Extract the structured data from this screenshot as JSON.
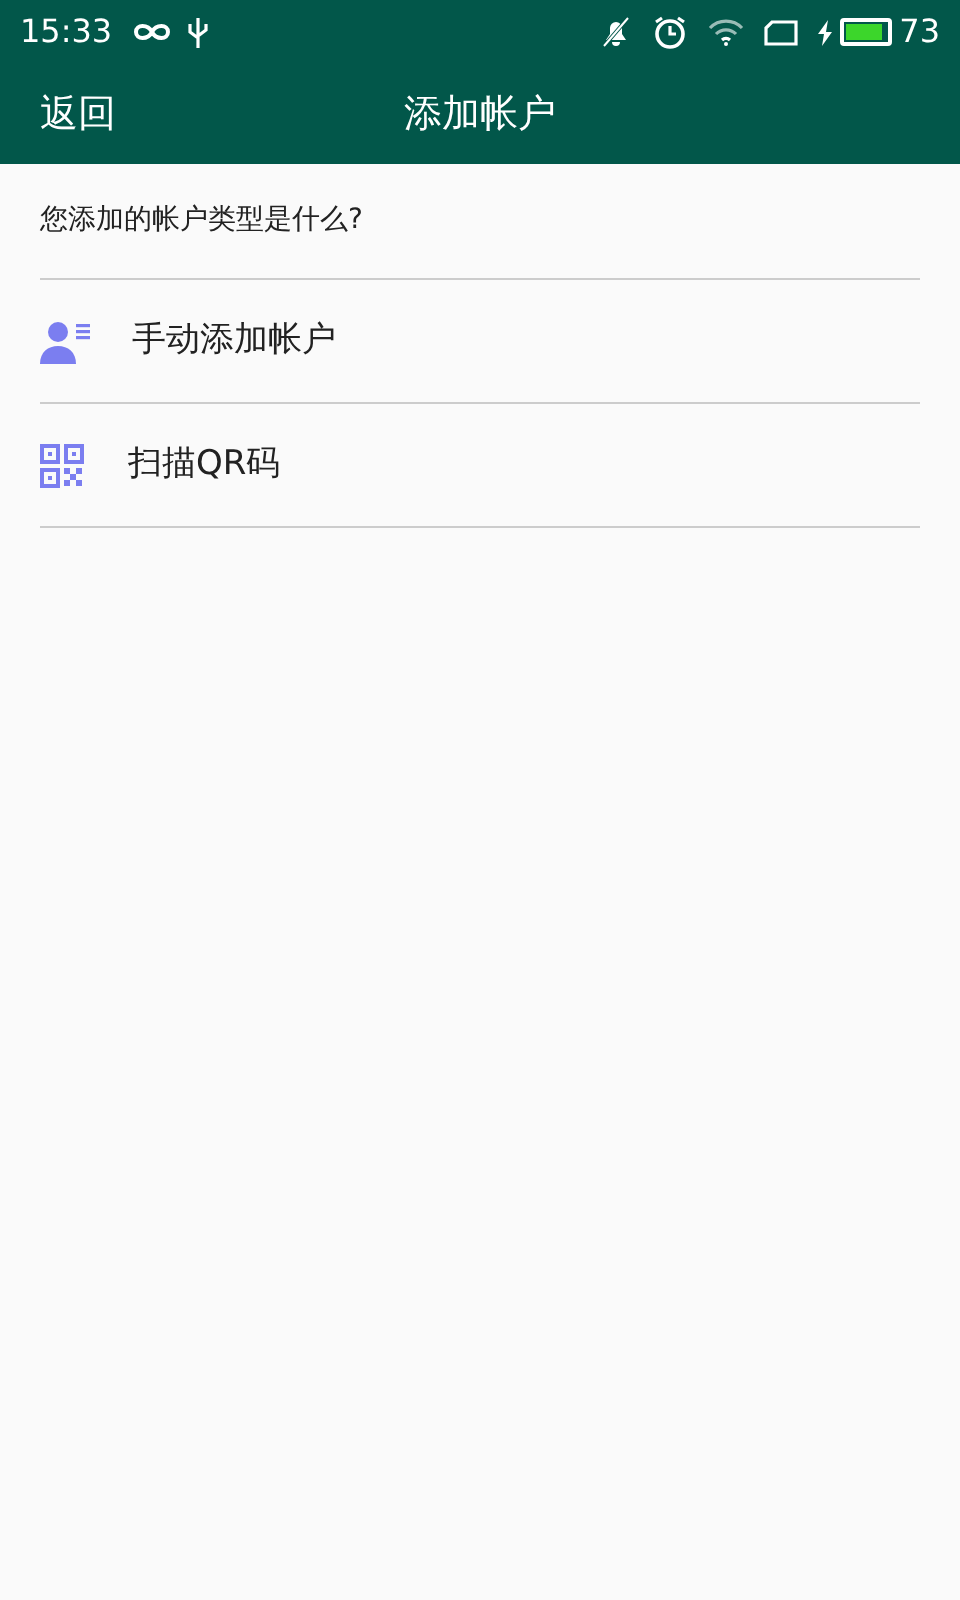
{
  "status_bar": {
    "time": "15:33",
    "battery": {
      "reading": "73"
    }
  },
  "header": {
    "back": "返回",
    "title": "添加帐户"
  },
  "prompt": "您添加的帐户类型是什么?",
  "options": [
    {
      "kind": "manual",
      "label": "手动添加帐户"
    },
    {
      "kind": "qr",
      "label": "扫描QR码"
    }
  ]
}
